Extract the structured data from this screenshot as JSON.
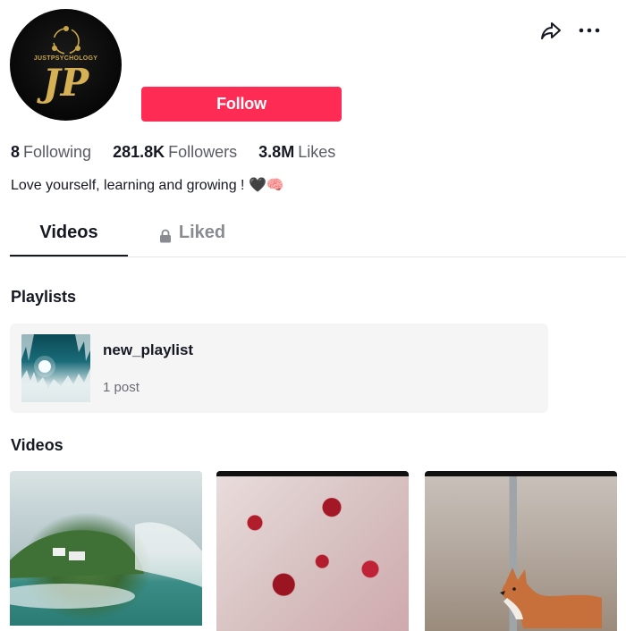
{
  "profile": {
    "avatar": {
      "brand_text": "JUSTPSYCHOLOGY",
      "monogram": "JP"
    },
    "follow_label": "Follow",
    "stats": [
      {
        "value": "8",
        "label": "Following"
      },
      {
        "value": "281.8K",
        "label": "Followers"
      },
      {
        "value": "3.8M",
        "label": "Likes"
      }
    ],
    "bio": "Love yourself, learning and growing ! 🖤🧠"
  },
  "header": {
    "icons": [
      "share-icon",
      "more-icon"
    ]
  },
  "tabs": [
    {
      "label": "Videos",
      "active": true
    },
    {
      "label": "Liked",
      "active": false,
      "locked": true
    }
  ],
  "playlists": {
    "title": "Playlists",
    "items": [
      {
        "name": "new_playlist",
        "count": "1 post"
      }
    ]
  },
  "videos": {
    "title": "Videos"
  },
  "colors": {
    "accent": "#fe2c55",
    "text": "#161823",
    "muted": "#8a8b91"
  }
}
